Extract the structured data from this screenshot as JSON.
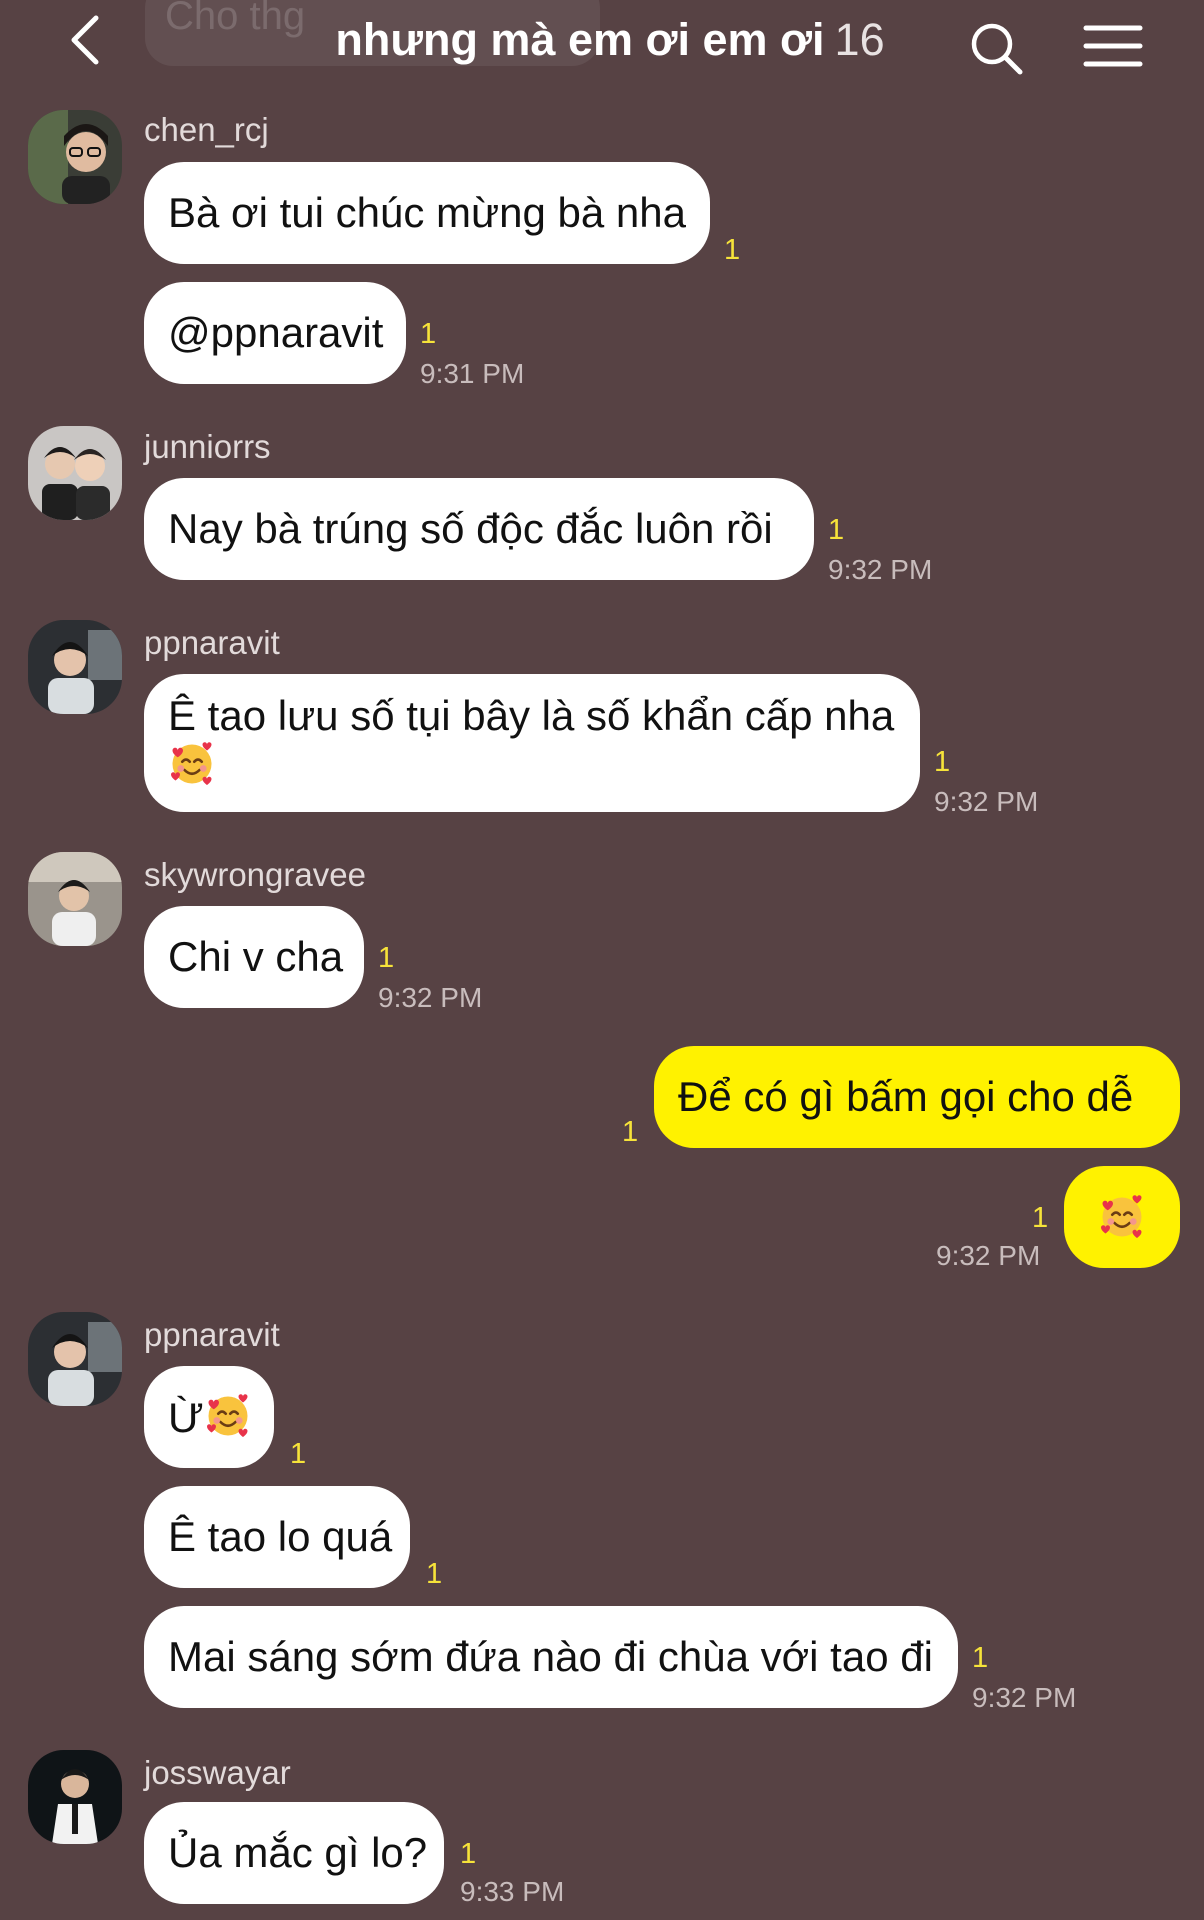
{
  "header": {
    "title": "nhưng mà em ơi em ơi",
    "member_count": "16",
    "ghost_text": "Cho thg"
  },
  "icons": {
    "back": "chevron-left-icon",
    "search": "search-icon",
    "menu": "hamburger-menu-icon",
    "emoji": "smiling-face-with-hearts-emoji"
  },
  "colors": {
    "background": "#574244",
    "incoming_bubble": "#ffffff",
    "outgoing_bubble": "#fff200",
    "unread_count": "#f6e33a"
  },
  "messages": [
    {
      "sender": "chen_rcj",
      "text": "Bà ơi tui chúc mừng bà nha",
      "unread": "1"
    },
    {
      "sender": "chen_rcj",
      "text": "@ppnaravit",
      "unread": "1",
      "time": "9:31 PM"
    },
    {
      "sender": "junniorrs",
      "text": "Nay bà trúng số độc đắc luôn rồi",
      "unread": "1",
      "time": "9:32 PM"
    },
    {
      "sender": "ppnaravit",
      "text": "Ê tao lưu số tụi bây là số khẩn cấp nha",
      "unread": "1",
      "time": "9:32 PM"
    },
    {
      "sender": "skywrongravee",
      "text": "Chi v cha",
      "unread": "1",
      "time": "9:32 PM"
    },
    {
      "sender": "me",
      "text": "Để có gì bấm gọi cho dễ",
      "unread": "1"
    },
    {
      "sender": "me",
      "text": "",
      "unread": "1",
      "time": "9:32 PM"
    },
    {
      "sender": "ppnaravit",
      "text": "Ừ",
      "unread": "1"
    },
    {
      "sender": "ppnaravit",
      "text": "Ê tao lo quá",
      "unread": "1"
    },
    {
      "sender": "ppnaravit",
      "text": "Mai sáng sớm đứa nào đi chùa với tao đi",
      "unread": "1",
      "time": "9:32 PM"
    },
    {
      "sender": "josswayar",
      "text": "Ủa mắc gì lo?",
      "unread": "1",
      "time": "9:33 PM"
    }
  ]
}
